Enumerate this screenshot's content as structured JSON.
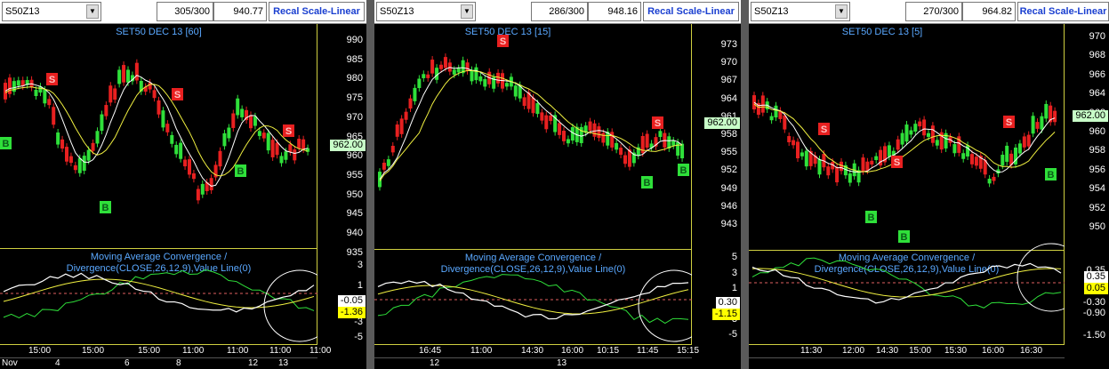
{
  "panels": [
    {
      "symbol": "S50Z13",
      "count": "305/300",
      "last": "940.77",
      "recal": "Recal Scale-Linear",
      "title": "SET50 DEC 13  [60]",
      "price_ticks": [
        "990",
        "985",
        "980",
        "975",
        "970",
        "965",
        "960",
        "955",
        "950",
        "945",
        "940",
        "935"
      ],
      "price_last": "962.00",
      "macd_title_1": "Moving Average Convergence /",
      "macd_title_2": "Divergence(CLOSE,26,12,9),Value Line(0)",
      "macd_ticks": [
        "3",
        "1",
        "-1",
        "-3",
        "-5"
      ],
      "macd_last_1": "-0.05",
      "macd_last_2": "-1.36",
      "times": [
        "15:00",
        "15:00",
        "15:00",
        "11:00",
        "11:00",
        "11:00",
        "11:00"
      ],
      "dates": [
        "Nov",
        "4",
        "6",
        "8",
        "12",
        "13"
      ]
    },
    {
      "symbol": "S50Z13",
      "count": "286/300",
      "last": "948.16",
      "recal": "Recal Scale-Linear",
      "title": "SET50 DEC 13   [15]",
      "price_ticks": [
        "973",
        "970",
        "967",
        "964",
        "961",
        "958",
        "955",
        "952",
        "949",
        "946",
        "943"
      ],
      "price_last": "962.00",
      "macd_title_1": "Moving Average Convergence /",
      "macd_title_2": "Divergence(CLOSE,26,12,9),Value Line(0)",
      "macd_ticks": [
        "5",
        "3",
        "1",
        "-1",
        "-3",
        "-5"
      ],
      "macd_last_1": "0.30",
      "macd_last_2": "-1.15",
      "times": [
        "16:45",
        "11:00",
        "14:30",
        "16:00",
        "10:15",
        "11:45",
        "15:15"
      ],
      "dates": [
        "12",
        "13"
      ]
    },
    {
      "symbol": "S50Z13",
      "count": "270/300",
      "last": "964.82",
      "recal": "Recal Scale-Linear",
      "title": "SET50 DEC 13   [5]",
      "price_ticks": [
        "970",
        "968",
        "966",
        "964",
        "962",
        "960",
        "958",
        "956",
        "954",
        "952",
        "950"
      ],
      "price_last": "962.00",
      "macd_title_1": "Moving Average Convergence /",
      "macd_title_2": "Divergence(CLOSE,26,12,9),Value Line(0)",
      "macd_ticks": [
        "0.35",
        "0.05",
        "-0.30",
        "-0.90",
        "-1.50"
      ],
      "macd_last_1": "0.35",
      "macd_last_2": "0.05",
      "times": [
        "11:30",
        "12:00",
        "14:30",
        "15:00",
        "15:30",
        "16:00",
        "16:30"
      ],
      "dates": []
    }
  ],
  "signals": {
    "sell": "S",
    "buy": "B"
  },
  "colors": {
    "bull": "#2fe03a",
    "bear": "#e82020",
    "ma_fast": "#ffffff",
    "ma_slow": "#f0f040",
    "macd": "#ffffff",
    "signal": "#f0f040",
    "hist": "#2fe03a",
    "axis": "#cfcf40",
    "title": "#5aa8ff",
    "price_box": "#c8ffc8",
    "macd_box1": "#ffffff",
    "macd_box2": "#ffff00"
  }
}
